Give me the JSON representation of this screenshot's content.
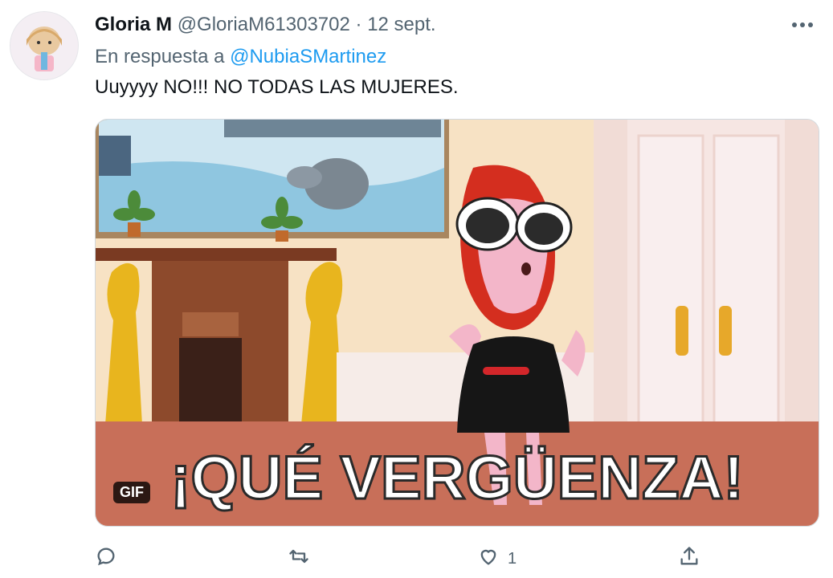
{
  "tweet": {
    "display_name": "Gloria M",
    "handle": "@GloriaM61303702",
    "separator": "·",
    "date": "12 sept.",
    "reply_prefix": "En respuesta a",
    "reply_to": "@NubiaSMartinez",
    "text": "Uuyyyy NO!!! NO TODAS LAS MUJERES.",
    "media": {
      "type": "gif",
      "badge": "GIF",
      "caption": "¡QUÉ VERGÜENZA!"
    },
    "actions": {
      "reply_icon": "reply-icon",
      "retweet_icon": "retweet-icon",
      "like_icon": "heart-icon",
      "like_count": "1",
      "share_icon": "share-icon"
    }
  },
  "colors": {
    "accent": "#1d9bf0",
    "muted": "#536471",
    "text": "#0f1419"
  }
}
